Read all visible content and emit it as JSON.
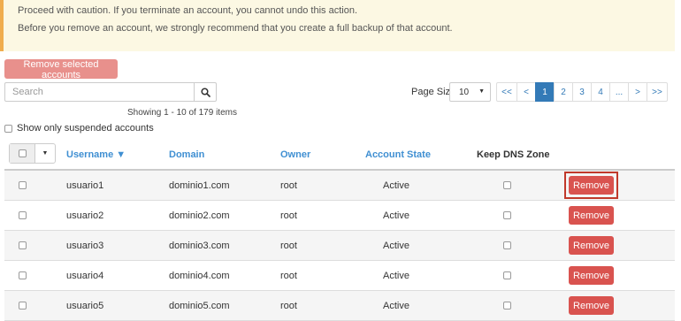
{
  "warning": {
    "line1": "Proceed with caution. If you terminate an account, you cannot undo this action.",
    "line2": "Before you remove an account, we strongly recommend that you create a full backup of that account."
  },
  "toolbar": {
    "remove_selected_label": "Remove selected accounts",
    "search_placeholder": "Search",
    "search_value": ""
  },
  "showing": "Showing 1 - 10 of 179 items",
  "pagination": {
    "page_size_label": "Page Size",
    "page_size_value": "10",
    "items": [
      "<<",
      "<",
      "1",
      "2",
      "3",
      "4",
      "...",
      ">",
      ">>"
    ],
    "active": "1"
  },
  "filter": {
    "suspended_label": "Show only suspended accounts"
  },
  "table": {
    "columns": {
      "username": "Username ▼",
      "domain": "Domain",
      "owner": "Owner",
      "state": "Account State",
      "keep_dns": "Keep DNS Zone"
    },
    "remove_label": "Remove",
    "rows": [
      {
        "username": "usuario1",
        "domain": "dominio1.com",
        "owner": "root",
        "state": "Active"
      },
      {
        "username": "usuario2",
        "domain": "dominio2.com",
        "owner": "root",
        "state": "Active"
      },
      {
        "username": "usuario3",
        "domain": "dominio3.com",
        "owner": "root",
        "state": "Active"
      },
      {
        "username": "usuario4",
        "domain": "dominio4.com",
        "owner": "root",
        "state": "Active"
      },
      {
        "username": "usuario5",
        "domain": "dominio5.com",
        "owner": "root",
        "state": "Active"
      }
    ]
  },
  "colors": {
    "accent": "#337ab7",
    "header_link": "#3f8fd2",
    "danger": "#d9534f",
    "danger_disabled": "#e8908c",
    "warning_bg": "#fcf8e3",
    "warning_border": "#f0ad4e"
  },
  "icons": {
    "search": "search-icon",
    "dropdown": "caret-down-icon"
  }
}
